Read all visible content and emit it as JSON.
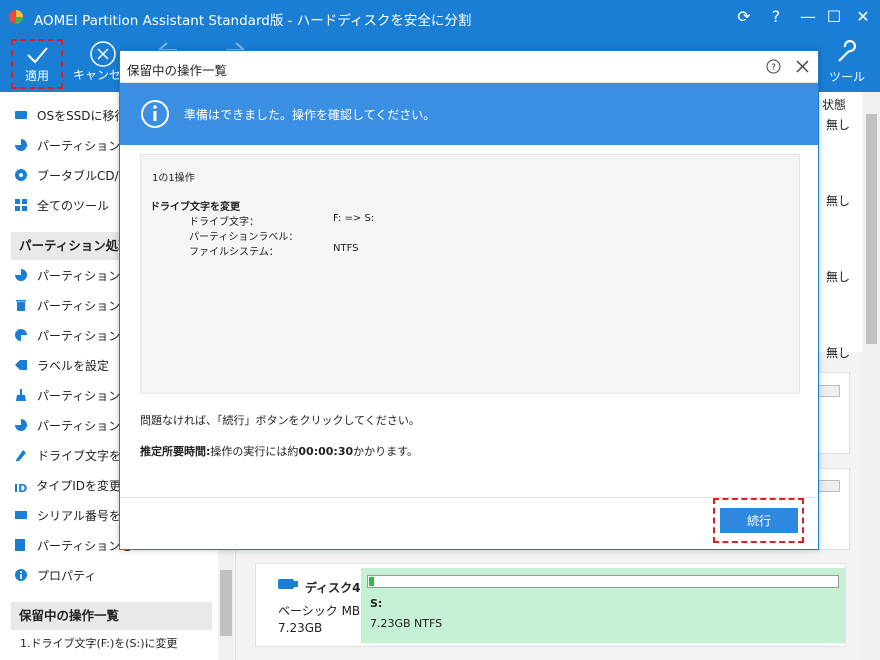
{
  "window": {
    "title": "AOMEI Partition Assistant Standard版 - ハードディスクを安全に分割",
    "controls": [
      "refresh-icon",
      "help-icon",
      "minimize-icon",
      "maximize-icon",
      "close-icon"
    ]
  },
  "toolbar": {
    "apply_label": "適用",
    "cancel_label": "キャンセル",
    "tools_label": "ツール"
  },
  "sidebar": {
    "wizard_items": [
      {
        "label": "OSをSSDに移行",
        "icon": "os-migrate-icon"
      },
      {
        "label": "パーティションを",
        "icon": "partition-icon"
      },
      {
        "label": "ブータブルCD/U",
        "icon": "bootable-cd-icon"
      },
      {
        "label": "全てのツール",
        "icon": "all-tools-icon"
      }
    ],
    "partition_header": "パーティション処理",
    "partition_items": [
      {
        "label": "パーティションを",
        "icon": "partition-resize-icon"
      },
      {
        "label": "パーティションを",
        "icon": "delete-partition-icon"
      },
      {
        "label": "パーティションを",
        "icon": "format-partition-icon"
      },
      {
        "label": "ラベルを設定",
        "icon": "label-icon"
      },
      {
        "label": "パーティションを",
        "icon": "wipe-partition-icon"
      },
      {
        "label": "パーティションパ",
        "icon": "partition-chart-icon"
      },
      {
        "label": "ドライブ文字を",
        "icon": "drive-letter-icon"
      },
      {
        "label": "タイプIDを変更",
        "icon": "type-id-icon"
      },
      {
        "label": "シリアル番号を",
        "icon": "serial-number-icon"
      },
      {
        "label": "パーティションを",
        "icon": "partition-align-icon"
      },
      {
        "label": "プロパティ",
        "icon": "info-icon"
      }
    ],
    "pending_header": "保留中の操作一覧",
    "pending_items": [
      "1.ドライブ文字(F:)を(S:)に変更"
    ]
  },
  "status_column": {
    "header": "状態",
    "values": [
      "無し",
      "無し",
      "無し",
      "無し"
    ]
  },
  "disk4": {
    "name": "ディスク4",
    "type": "ベーシック MBR",
    "size": "7.23GB",
    "partition_label": "S:",
    "partition_info": "7.23GB NTFS",
    "used_fraction": 0.01
  },
  "modal": {
    "title": "保留中の操作一覧",
    "info_text": "準備はできました。操作を確認してください。",
    "op_count": "1の1操作",
    "op_title": "ドライブ文字を変更",
    "op_rows": [
      {
        "key": "ドライブ文字：",
        "value": "F: => S:"
      },
      {
        "key": "パーティションラベル：",
        "value": ""
      },
      {
        "key": "ファイルシステム：",
        "value": "NTFS"
      }
    ],
    "confirm_text": "問題なければ、「続行」ボタンをクリックしてください。",
    "time_label": "推定所要時間:",
    "time_prefix": "操作の実行には約",
    "time_value": "00:00:30",
    "time_suffix": "かかります。",
    "continue_label": "続行"
  },
  "colors": {
    "titlebar": "#1a7fd4",
    "info_banner": "#3b8fe3",
    "button": "#2e88e0",
    "highlight": "#e02020",
    "partition": "#c5f0d6"
  }
}
